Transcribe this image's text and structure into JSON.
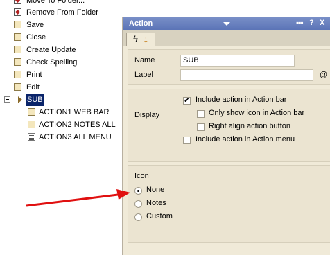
{
  "tree": {
    "items": [
      {
        "label": "Move To Folder..."
      },
      {
        "label": "Remove From Folder"
      },
      {
        "label": "Save"
      },
      {
        "label": "Close"
      },
      {
        "label": "Create Update"
      },
      {
        "label": "Check Spelling"
      },
      {
        "label": "Print"
      },
      {
        "label": "Edit"
      }
    ],
    "group": {
      "label": "SUB",
      "expanded": true,
      "selected": true
    },
    "children": [
      {
        "label": "ACTION1 WEB BAR"
      },
      {
        "label": "ACTION2 NOTES ALL"
      },
      {
        "label": "ACTION3 ALL MENU"
      }
    ]
  },
  "panel": {
    "title": "Action",
    "header_buttons": {
      "dots": "▪▪▪",
      "help": "?",
      "close": "X"
    },
    "tabs": [
      {
        "icons": [
          "lightning-icon",
          "figure-icon"
        ]
      }
    ],
    "name_label": "Name",
    "name_value": "SUB",
    "label_label": "Label",
    "label_value": "",
    "formula_button": "@",
    "display": {
      "label": "Display",
      "options": [
        {
          "text": "Include action in Action bar",
          "checked": true
        },
        {
          "text": "Only show icon in Action bar",
          "checked": false
        },
        {
          "text": "Right align action button",
          "checked": false
        },
        {
          "text": "Include action in Action menu",
          "checked": false
        }
      ]
    },
    "icon": {
      "label": "Icon",
      "options": [
        {
          "text": "None",
          "selected": true
        },
        {
          "text": "Notes",
          "selected": false
        },
        {
          "text": "Custom",
          "selected": false
        }
      ]
    }
  },
  "colors": {
    "title_bar": "#5a73b6",
    "panel_bg": "#f0ead8",
    "selection": "#0a246a",
    "annotation_arrow": "#e01010"
  }
}
